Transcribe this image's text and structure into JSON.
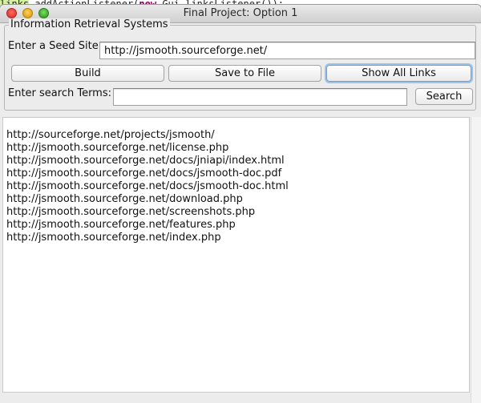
{
  "background_code": {
    "prefix": "links",
    "method": ".addActionListener(",
    "keyword": "new",
    "rest": " Gui.linksListener());"
  },
  "window": {
    "title": "Final Project: Option 1"
  },
  "panel": {
    "legend": "Information Retrieval Systems",
    "seed_label": "Enter a Seed Site:",
    "seed_value": "http://jsmooth.sourceforge.net/",
    "build_label": "Build",
    "save_label": "Save to File",
    "show_links_label": "Show All Links",
    "search_label": "Enter search Terms:",
    "search_value": "",
    "search_button_label": "Search"
  },
  "results": {
    "links": [
      "http://sourceforge.net/projects/jsmooth/",
      "http://jsmooth.sourceforge.net/license.php",
      "http://jsmooth.sourceforge.net/docs/jniapi/index.html",
      "http://jsmooth.sourceforge.net/docs/jsmooth-doc.pdf",
      "http://jsmooth.sourceforge.net/docs/jsmooth-doc.html",
      "http://jsmooth.sourceforge.net/download.php",
      "http://jsmooth.sourceforge.net/screenshots.php",
      "http://jsmooth.sourceforge.net/features.php",
      "http://jsmooth.sourceforge.net/index.php"
    ]
  },
  "colors": {
    "focus_ring": "#9cc2ee",
    "close": "#ff5f57",
    "minimize": "#ffbd2e",
    "maximize": "#28c940"
  },
  "icons": [
    "close-icon",
    "minimize-icon",
    "maximize-icon"
  ]
}
